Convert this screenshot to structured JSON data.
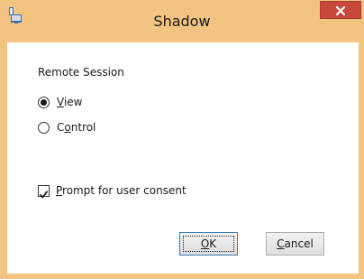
{
  "window": {
    "title": "Shadow",
    "close_glyph": "x",
    "icon": "shadow-app-icon",
    "frame_color": "#f3c382",
    "close_color": "#c9483d"
  },
  "group": {
    "label": "Remote Session"
  },
  "radios": [
    {
      "pre": "",
      "mnemonic": "V",
      "rest": "iew",
      "selected": true
    },
    {
      "pre": "C",
      "mnemonic": "o",
      "rest": "ntrol",
      "selected": false
    }
  ],
  "consent": {
    "mnemonic": "P",
    "rest": "rompt for user consent",
    "checked": true
  },
  "buttons": {
    "ok": {
      "mnemonic": "O",
      "rest": "K"
    },
    "cancel": {
      "mnemonic": "C",
      "rest": "ancel"
    }
  }
}
